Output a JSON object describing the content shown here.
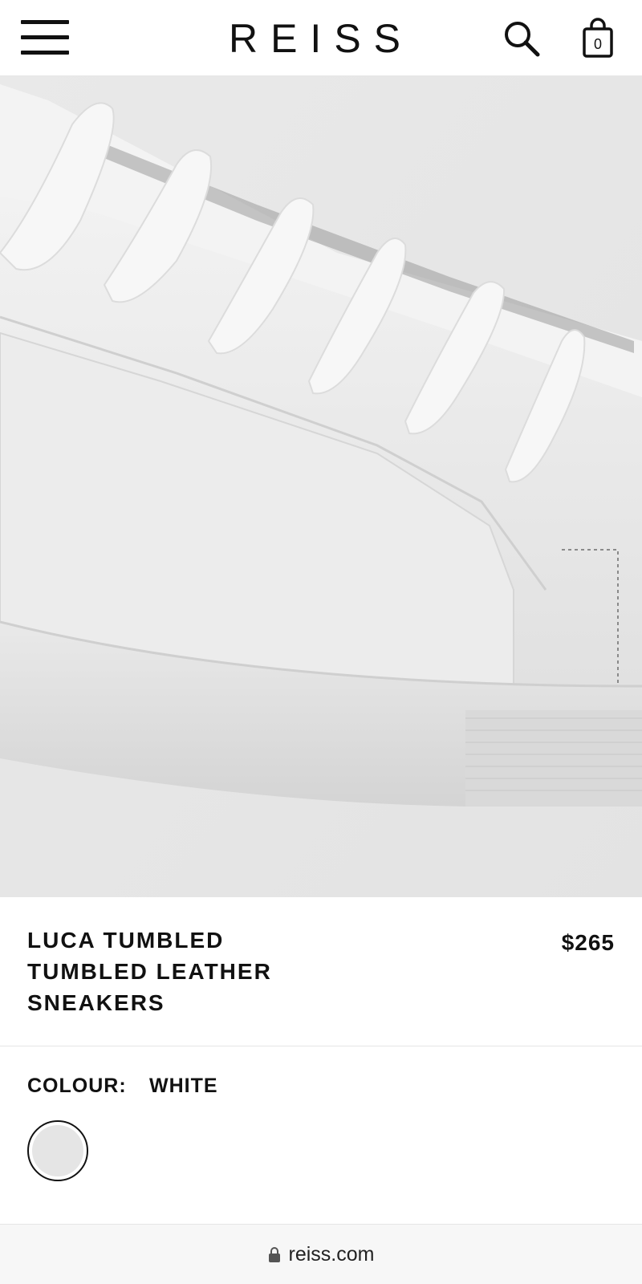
{
  "header": {
    "logo": "REISS",
    "bag_count": "0"
  },
  "gallery": {
    "image_subject": "white-leather-sneaker-closeup",
    "slide_count": 5,
    "active_slide": 1
  },
  "product": {
    "title_lines": [
      "LUCA TUMBLED",
      "TUMBLED LEATHER",
      "SNEAKERS"
    ],
    "price": "$265"
  },
  "colour": {
    "label": "COLOUR:",
    "value": "WHITE",
    "swatch_color": "#e5e5e5"
  },
  "browser": {
    "url": "reiss.com"
  },
  "icons": {
    "menu": "hamburger-menu-icon",
    "search": "search-icon",
    "bag": "shopping-bag-icon",
    "expand": "expand-icon",
    "lock": "lock-icon"
  }
}
